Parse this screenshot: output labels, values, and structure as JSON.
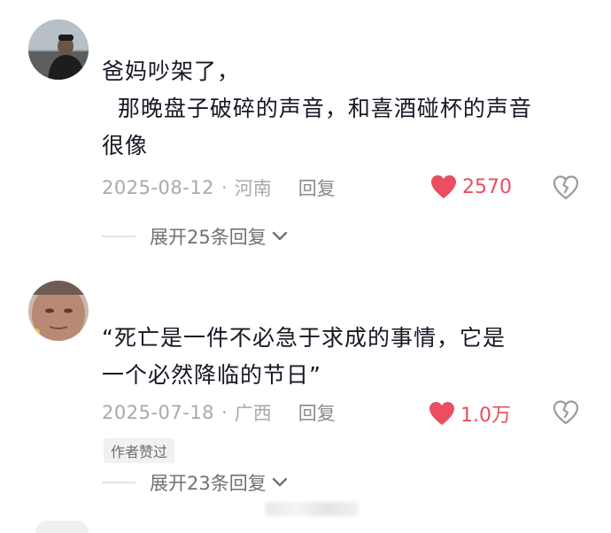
{
  "comments": [
    {
      "text": "爸妈吵架了，\n  那晚盘子破碎的声音，和喜酒碰杯的声音\n很像",
      "date": "2025-08-12",
      "location": "河南",
      "reply_label": "回复",
      "likes": "2570",
      "expand_label": "展开25条回复"
    },
    {
      "text": "“死亡是一件不必急于求成的事情，它是\n一个必然降临的节日”",
      "date": "2025-07-18",
      "location": "广西",
      "reply_label": "回复",
      "likes": "1.0万",
      "author_badge": "作者赞过",
      "expand_label": "展开23条回复"
    }
  ],
  "separator": "·",
  "colors": {
    "like": "#ea4e60",
    "meta": "#a9a9ae",
    "text": "#161823"
  }
}
